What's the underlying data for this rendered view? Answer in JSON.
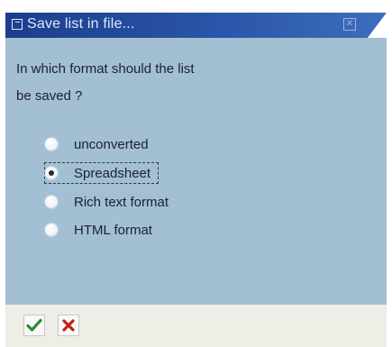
{
  "dialog": {
    "title": "Save list in file...",
    "prompt_line1": "In which format should the list",
    "prompt_line2": "be saved ?",
    "options": [
      {
        "label": "unconverted",
        "selected": false
      },
      {
        "label": "Spreadsheet",
        "selected": true
      },
      {
        "label": "Rich text format",
        "selected": false
      },
      {
        "label": "HTML format",
        "selected": false
      }
    ],
    "buttons": {
      "ok_icon": "checkmark-icon",
      "cancel_icon": "cross-icon"
    },
    "colors": {
      "title_bar": "#1b3e8c",
      "body_background": "#a3bfd3",
      "footer_background": "#eeeee6",
      "ok_green": "#2e8b2e",
      "cancel_red": "#c0201a"
    }
  }
}
